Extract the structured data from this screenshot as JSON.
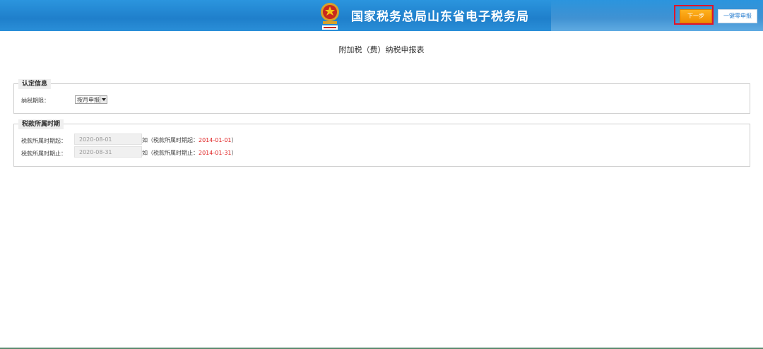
{
  "header": {
    "site_title": "国家税务总局山东省电子税务局",
    "next_button": "下一步",
    "zero_report_button": "一键零申报"
  },
  "page_title": "附加税（费）纳税申报表",
  "recognition": {
    "legend": "认定信息",
    "period_label": "纳税期限：",
    "period_value": "按月申报"
  },
  "tax_period": {
    "legend": "税款所属时期",
    "start_label": "税款所属时期起：",
    "start_value": "2020-08-01",
    "start_hint_prefix": "如（税款所属时期起：",
    "start_hint_example": "2014-01-01",
    "start_hint_suffix": "）",
    "end_label": "税款所属时期止：",
    "end_value": "2020-08-31",
    "end_hint_prefix": "如（税款所属时期止：",
    "end_hint_example": "2014-01-31",
    "end_hint_suffix": "）"
  },
  "colors": {
    "header_blue": "#1f7fcb",
    "next_orange": "#f39800",
    "highlight_red": "#e0142a",
    "hint_red": "#e02020"
  }
}
